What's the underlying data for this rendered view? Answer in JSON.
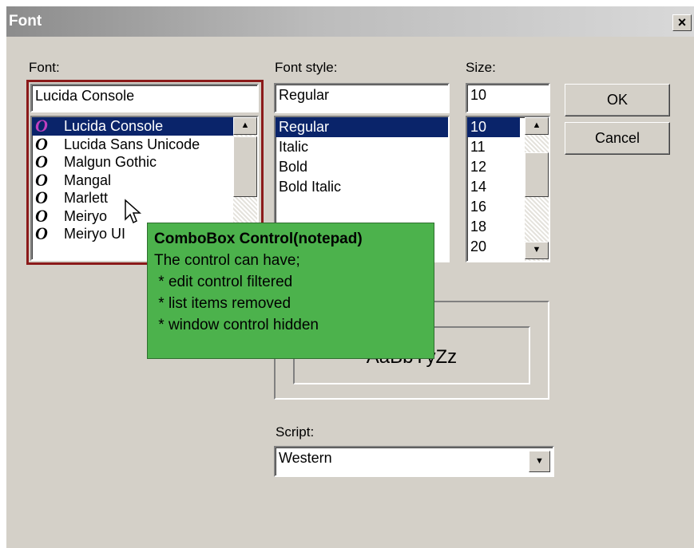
{
  "window": {
    "title": "Font",
    "close_glyph": "×"
  },
  "font": {
    "label": "Font:",
    "value": "Lucida Console",
    "items": [
      "Lucida Console",
      "Lucida Sans Unicode",
      "Malgun Gothic",
      "Mangal",
      "Marlett",
      "Meiryo",
      "Meiryo UI"
    ],
    "selected_index": 0,
    "item_icon": "opentype-font-icon"
  },
  "font_style": {
    "label": "Font style:",
    "value": "Regular",
    "items": [
      "Regular",
      "Italic",
      "Bold",
      "Bold Italic"
    ],
    "selected_index": 0
  },
  "size": {
    "label": "Size:",
    "value": "10",
    "items": [
      "10",
      "11",
      "12",
      "14",
      "16",
      "18",
      "20"
    ],
    "selected_index": 0
  },
  "buttons": {
    "ok": "OK",
    "cancel": "Cancel"
  },
  "sample": {
    "text": "AaBbYyZz"
  },
  "script": {
    "label": "Script:",
    "value": "Western"
  },
  "tooltip": {
    "title": "ComboBox Control(notepad)",
    "lines": [
      "The control can have;",
      " * edit control filtered",
      " * list items removed",
      " * window control hidden"
    ],
    "background": "#4cb24c"
  },
  "colors": {
    "selection": "#0a246a",
    "highlight_frame": "#8b1a1a",
    "dialog": "#d4d0c8"
  }
}
